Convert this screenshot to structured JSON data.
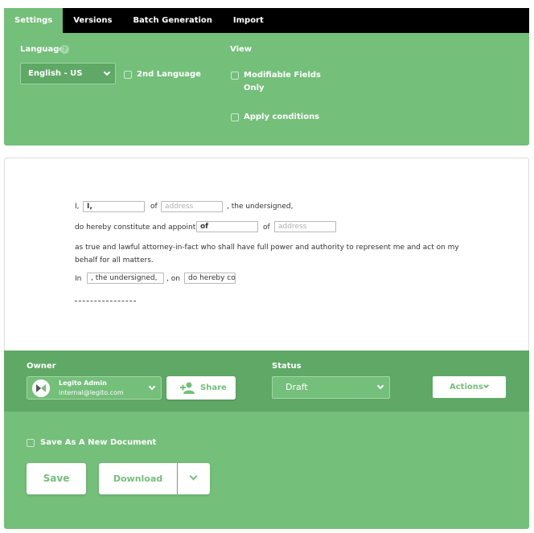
{
  "tabs": [
    {
      "label": "Settings",
      "active": true
    },
    {
      "label": "Versions"
    },
    {
      "label": "Batch Generation"
    },
    {
      "label": "Import"
    }
  ],
  "settings": {
    "language_label": "Language",
    "language_value": "English - US",
    "second_language_label": "2nd Language",
    "view_label": "View",
    "modifiable_fields_line1": "Modifiable Fields",
    "modifiable_fields_line2": "Only",
    "apply_conditions_label": "Apply conditions"
  },
  "document": {
    "line1": {
      "pre": "I,",
      "field1": "I,",
      "of": "of",
      "address_placeholder": "address",
      "post": ", the undersigned,"
    },
    "line2": {
      "pre": "do hereby constitute and appoint",
      "field1": "of",
      "of": "of",
      "address_placeholder": "address"
    },
    "line3": "as true and lawful attorney-in-fact who shall have full power and authority to represent me and act on my",
    "line4": "behalf for all matters.",
    "line5": {
      "pre": "In",
      "field1": ", the undersigned,",
      "on": ", on",
      "field2": "do hereby co"
    },
    "signature_line": "-------------------------"
  },
  "owner": {
    "label": "Owner",
    "name": "Legito Admin",
    "email": "internal@legito.com",
    "share_label": "Share"
  },
  "status": {
    "label": "Status",
    "value": "Draft"
  },
  "actions_label": "Actions",
  "save_as_new_label": "Save As A New Document",
  "save_label": "Save",
  "download_label": "Download",
  "colors": {
    "green": "#74bf7a",
    "dark_green": "#5fa866",
    "tab_bar": "#000000"
  }
}
